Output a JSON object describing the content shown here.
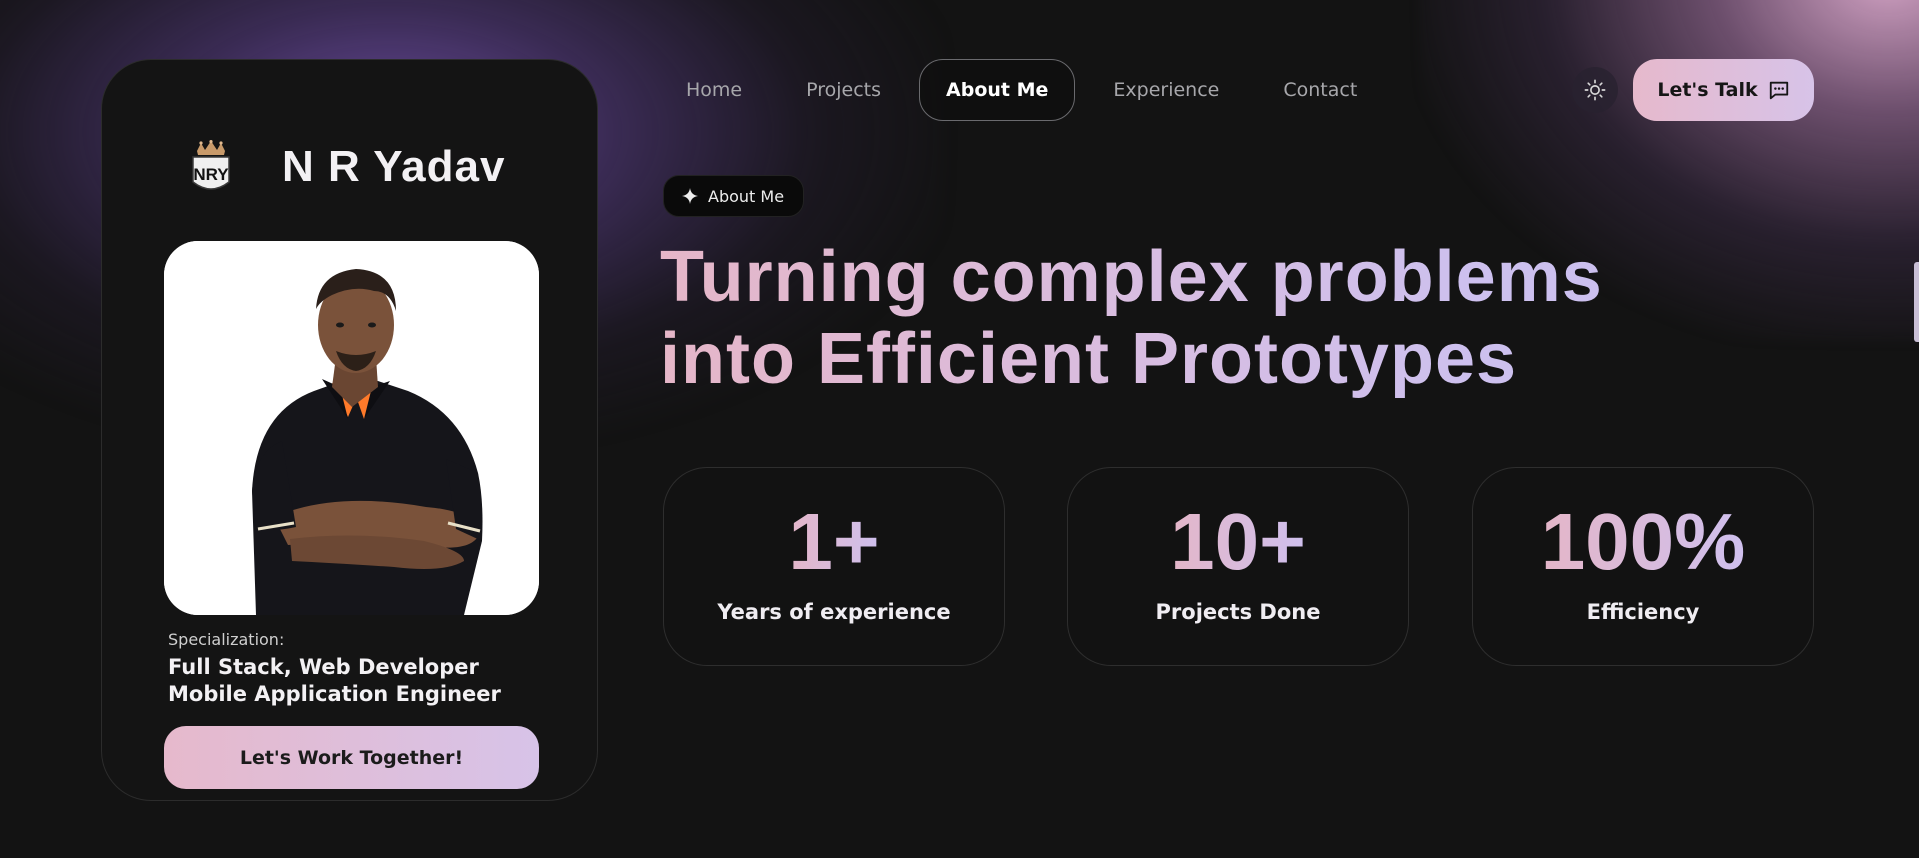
{
  "brand": {
    "logo_text": "NRY",
    "name": "N R Yadav"
  },
  "nav": {
    "items": [
      {
        "label": "Home",
        "active": false
      },
      {
        "label": "Projects",
        "active": false
      },
      {
        "label": "About Me",
        "active": true
      },
      {
        "label": "Experience",
        "active": false
      },
      {
        "label": "Contact",
        "active": false
      }
    ],
    "theme_icon": "sun-icon",
    "cta_label": "Let's Talk",
    "cta_icon": "message-square-icon"
  },
  "profile": {
    "photo_alt": "profile-photo",
    "specialization_label": "Specialization:",
    "specialization_line1": "Full Stack, Web Developer",
    "specialization_line2": "Mobile Application Engineer",
    "button_label": "Let's Work Together!"
  },
  "hero": {
    "badge_label": "About Me",
    "badge_icon": "sparkle-icon",
    "headline_line1": "Turning complex problems",
    "headline_line2": "into Efficient Prototypes"
  },
  "stats": [
    {
      "value": "1+",
      "label": "Years of experience"
    },
    {
      "value": "10+",
      "label": "Projects Done"
    },
    {
      "value": "100%",
      "label": "Efficiency"
    }
  ],
  "colors": {
    "background": "#131313",
    "accent_pink": "#e6b9cc",
    "accent_lavender": "#d7c3e8",
    "glow_purple": "#7855b4"
  }
}
